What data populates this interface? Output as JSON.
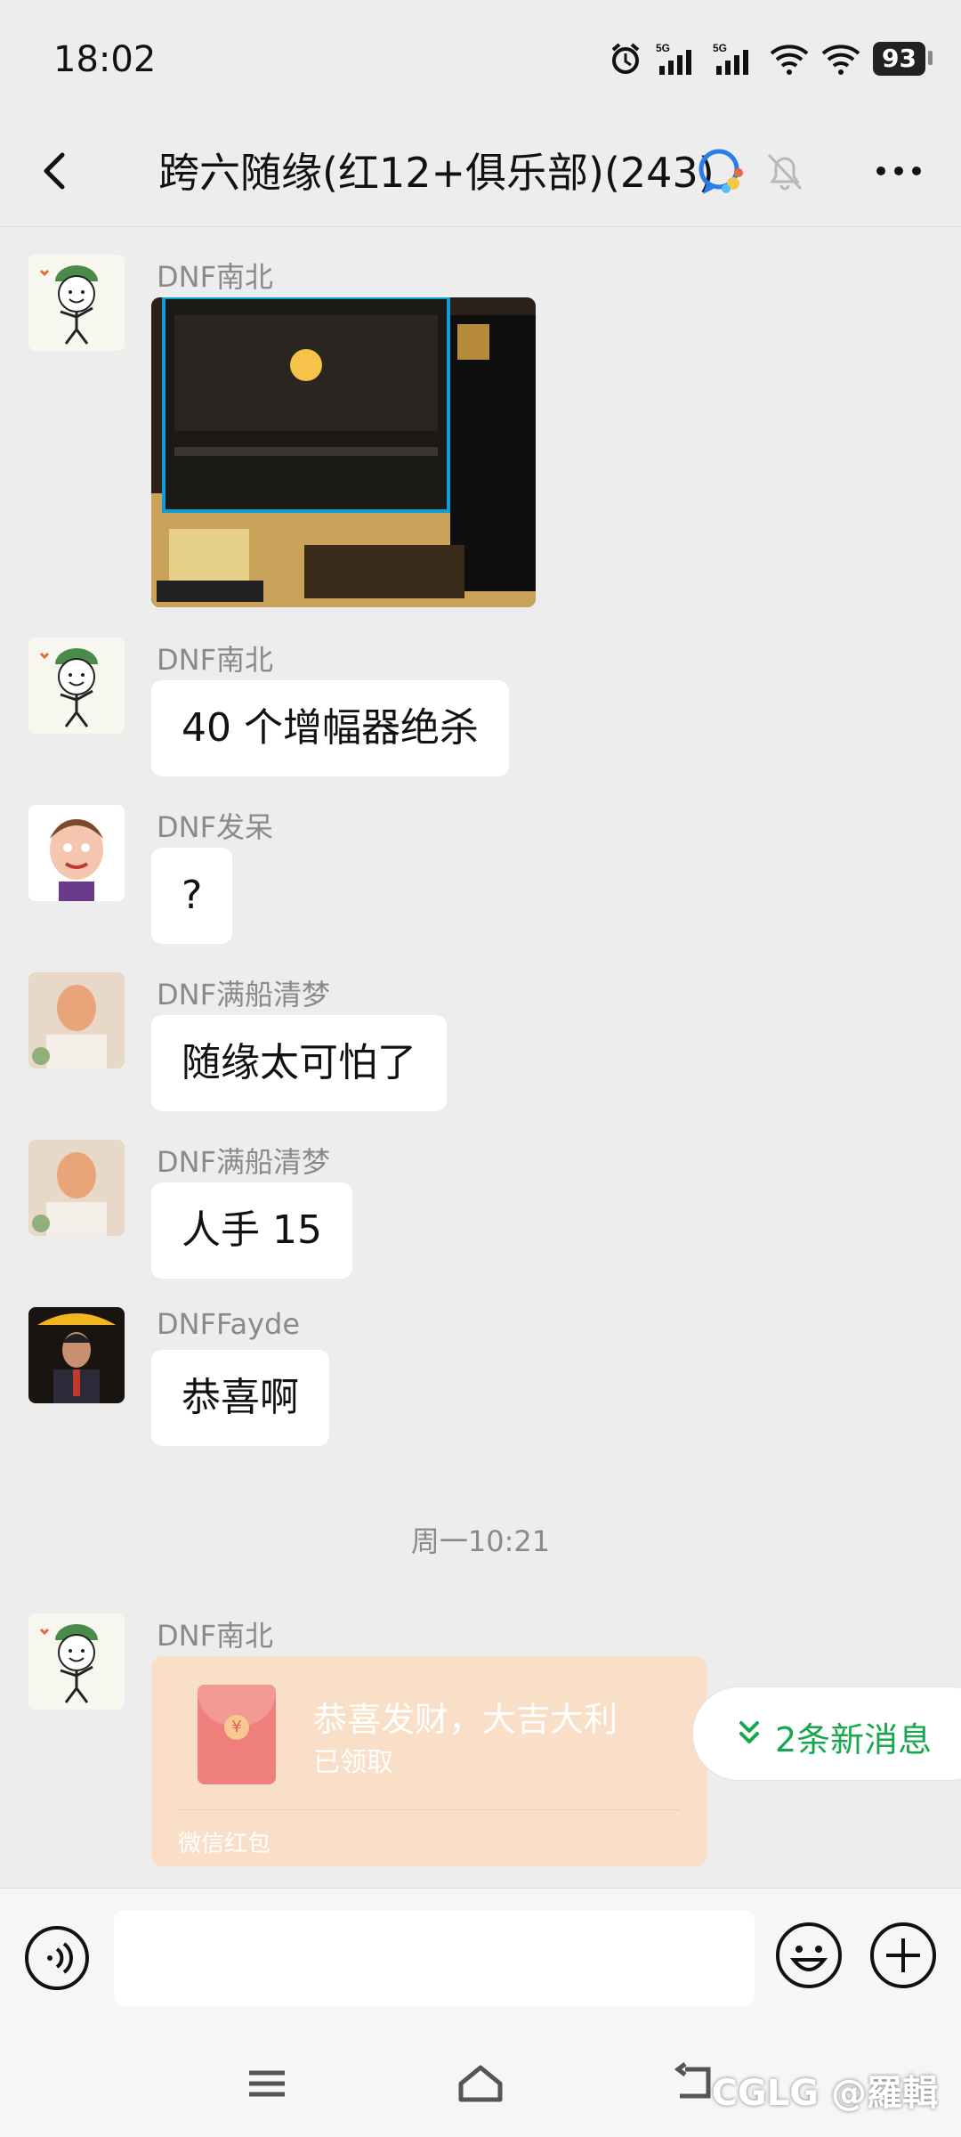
{
  "status": {
    "time": "18:02",
    "battery": "93"
  },
  "header": {
    "title": "跨六随缘(红12+俱乐部)(243)"
  },
  "messages": [
    {
      "sender": "DNF南北",
      "type": "image"
    },
    {
      "sender": "DNF南北",
      "text": "40 个增幅器绝杀"
    },
    {
      "sender": "DNF发呆",
      "text": "?"
    },
    {
      "sender": "DNF满船清梦",
      "text": "随缘太可怕了"
    },
    {
      "sender": "DNF满船清梦",
      "text": "人手 15"
    },
    {
      "sender": "DNFFayde",
      "text": "恭喜啊"
    }
  ],
  "timestamp": "周一10:21",
  "red_packet": {
    "sender": "DNF南北",
    "greeting": "恭喜发财，大吉大利",
    "state": "已领取",
    "label": "微信红包"
  },
  "new_messages": {
    "label": "2条新消息"
  },
  "watermark": "CGLG @羅輯",
  "colors": {
    "background": "#ededed",
    "bubble": "#ffffff",
    "accent_green": "#17a84d",
    "red_packet": "#f9dfc7"
  }
}
